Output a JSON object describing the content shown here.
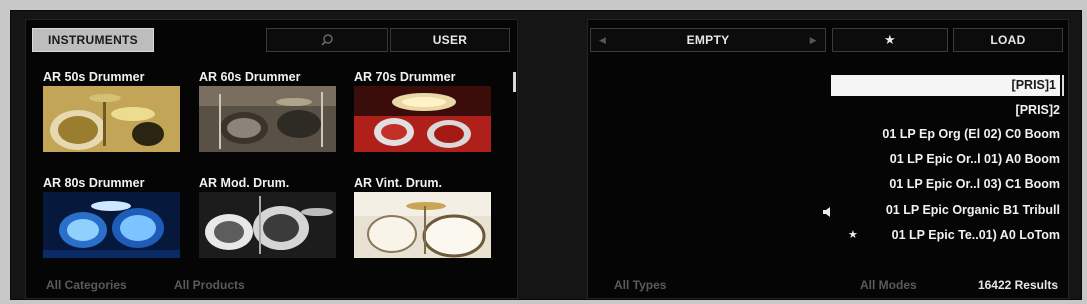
{
  "left_panel": {
    "instruments_tab": "INSTRUMENTS",
    "search_icon": "search-icon",
    "user_tab": "USER",
    "tiles": [
      {
        "label": "AR 50s Drummer"
      },
      {
        "label": "AR 60s Drummer"
      },
      {
        "label": "AR 70s Drummer"
      },
      {
        "label": "AR 80s Drummer"
      },
      {
        "label": "AR Mod. Drum."
      },
      {
        "label": "AR Vint. Drum."
      }
    ],
    "footer": {
      "categories": "All Categories",
      "products": "All Products"
    }
  },
  "right_panel": {
    "nav_prev_icon": "triangle-left-icon",
    "preset_name": "EMPTY",
    "nav_next_icon": "triangle-right-icon",
    "favorite_symbol": "★",
    "load_button": "LOAD",
    "results": [
      {
        "label": "[PRIS]1",
        "selected": true
      },
      {
        "label": "[PRIS]2"
      },
      {
        "label": "01 LP Ep Org (El 02) C0 Boom"
      },
      {
        "label": "01 LP Epic Or..l 01) A0 Boom"
      },
      {
        "label": "01 LP Epic Or..l 03) C1 Boom"
      },
      {
        "label": "01 LP Epic Organic B1 Tribull",
        "marker": "speaker-icon"
      },
      {
        "label": "01 LP Epic Te..01) A0 LoTom",
        "marker": "★"
      }
    ],
    "footer": {
      "types": "All Types",
      "modes": "All Modes",
      "results_count": "16422 Results"
    }
  },
  "colors": {
    "background": "#050505",
    "frame": "#151515",
    "selected_row": "#f5f5f5",
    "active_tab": "#bdbdbd"
  }
}
